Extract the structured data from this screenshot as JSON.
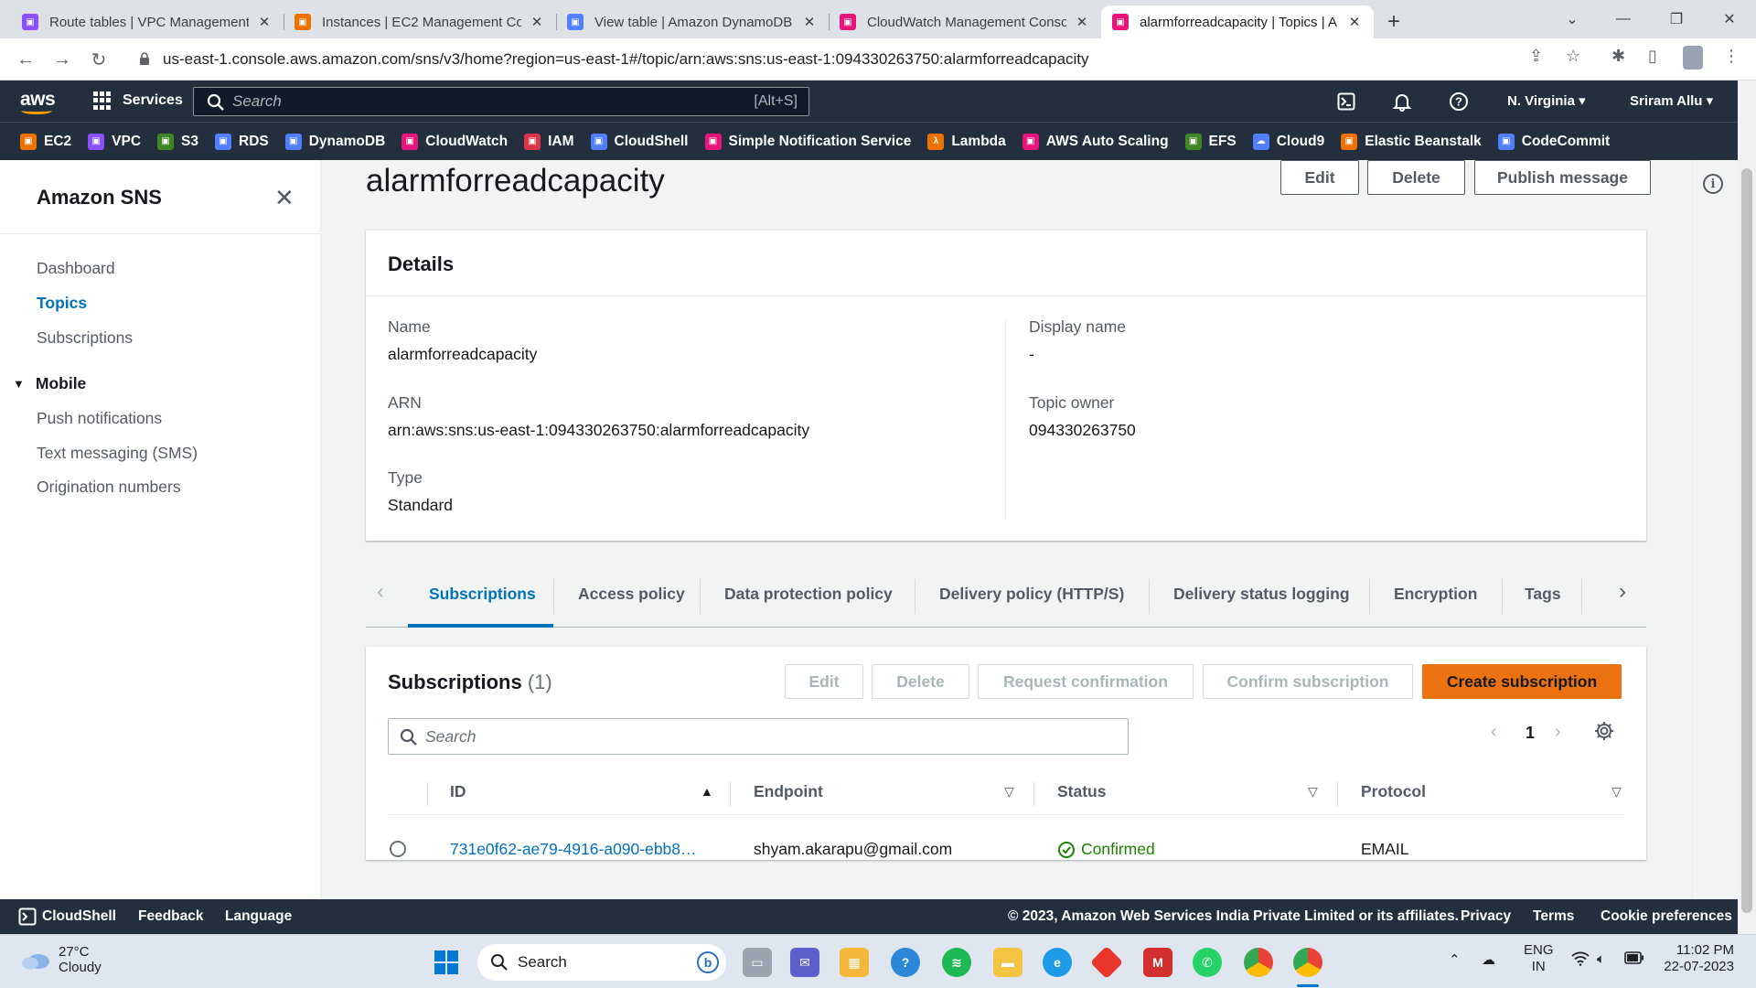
{
  "browser": {
    "tabs": [
      {
        "label": "Route tables | VPC Management",
        "color": "#8c4fff",
        "icon": "vpc-favicon"
      },
      {
        "label": "Instances | EC2 Management Con",
        "color": "#ed7100",
        "icon": "ec2-favicon"
      },
      {
        "label": "View table | Amazon DynamoDB",
        "color": "#527fff",
        "icon": "dynamodb-favicon"
      },
      {
        "label": "CloudWatch Management Conso",
        "color": "#e7157b",
        "icon": "cloudwatch-favicon"
      },
      {
        "label": "alarmforreadcapacity | Topics | A",
        "color": "#e7157b",
        "icon": "sns-favicon"
      }
    ],
    "url": "us-east-1.console.aws.amazon.com/sns/v3/home?region=us-east-1#/topic/arn:aws:sns:us-east-1:094330263750:alarmforreadcapacity"
  },
  "aws_nav": {
    "logo": "aws",
    "services_label": "Services",
    "search_placeholder": "Search",
    "search_shortcut": "[Alt+S]",
    "region": "N. Virginia",
    "user": "Sriram Allu"
  },
  "favorites": [
    {
      "label": "EC2",
      "color": "#ed7100"
    },
    {
      "label": "VPC",
      "color": "#8c4fff"
    },
    {
      "label": "S3",
      "color": "#3f8624"
    },
    {
      "label": "RDS",
      "color": "#527fff"
    },
    {
      "label": "DynamoDB",
      "color": "#527fff"
    },
    {
      "label": "CloudWatch",
      "color": "#e7157b"
    },
    {
      "label": "IAM",
      "color": "#dd344c"
    },
    {
      "label": "CloudShell",
      "color": "#527fff"
    },
    {
      "label": "Simple Notification Service",
      "color": "#e7157b"
    },
    {
      "label": "Lambda",
      "color": "#ed7100"
    },
    {
      "label": "AWS Auto Scaling",
      "color": "#e7157b"
    },
    {
      "label": "EFS",
      "color": "#3f8624"
    },
    {
      "label": "Cloud9",
      "color": "#527fff"
    },
    {
      "label": "Elastic Beanstalk",
      "color": "#ed7100"
    },
    {
      "label": "CodeCommit",
      "color": "#527fff"
    }
  ],
  "sidebar": {
    "title": "Amazon SNS",
    "items": [
      "Dashboard",
      "Topics",
      "Subscriptions"
    ],
    "section": "Mobile",
    "mobile_items": [
      "Push notifications",
      "Text messaging (SMS)",
      "Origination numbers"
    ]
  },
  "page": {
    "title": "alarmforreadcapacity",
    "actions": {
      "edit": "Edit",
      "delete": "Delete",
      "publish": "Publish message"
    }
  },
  "details": {
    "heading": "Details",
    "name_label": "Name",
    "name": "alarmforreadcapacity",
    "arn_label": "ARN",
    "arn": "arn:aws:sns:us-east-1:094330263750:alarmforreadcapacity",
    "type_label": "Type",
    "type": "Standard",
    "display_name_label": "Display name",
    "display_name": "-",
    "owner_label": "Topic owner",
    "owner": "094330263750"
  },
  "tabs": [
    "Subscriptions",
    "Access policy",
    "Data protection policy",
    "Delivery policy (HTTP/S)",
    "Delivery status logging",
    "Encryption",
    "Tags"
  ],
  "subscriptions": {
    "title": "Subscriptions",
    "count": "(1)",
    "buttons": {
      "edit": "Edit",
      "delete": "Delete",
      "request": "Request confirmation",
      "confirm": "Confirm subscription",
      "create": "Create subscription"
    },
    "search_placeholder": "Search",
    "page": "1",
    "columns": [
      "ID",
      "Endpoint",
      "Status",
      "Protocol"
    ],
    "rows": [
      {
        "id": "731e0f62-ae79-4916-a090-ebb8…",
        "endpoint": "shyam.akarapu@gmail.com",
        "status": "Confirmed",
        "protocol": "EMAIL"
      }
    ]
  },
  "footer": {
    "cloudshell": "CloudShell",
    "feedback": "Feedback",
    "language": "Language",
    "copyright": "© 2023, Amazon Web Services India Private Limited or its affiliates.",
    "privacy": "Privacy",
    "terms": "Terms",
    "cookies": "Cookie preferences"
  },
  "taskbar": {
    "temperature": "27°C",
    "weather": "Cloudy",
    "search": "Search",
    "lang1": "ENG",
    "lang2": "IN",
    "time": "11:02 PM",
    "date": "22-07-2023"
  }
}
